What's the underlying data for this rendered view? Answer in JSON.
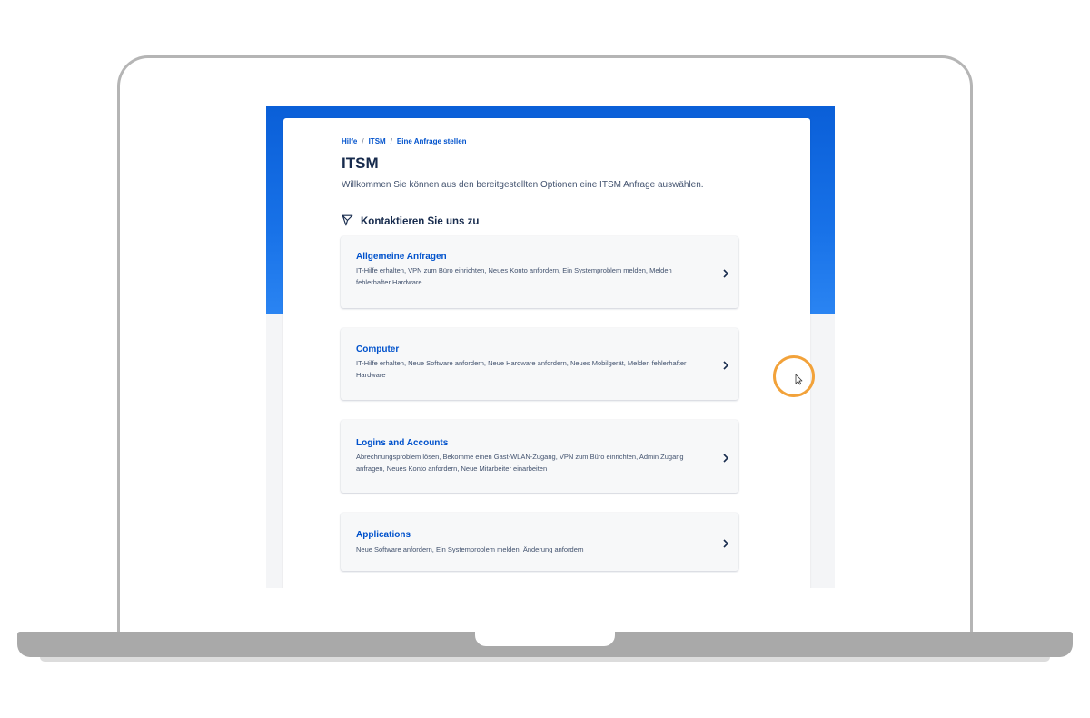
{
  "breadcrumb": [
    "Hilfe",
    "ITSM",
    "Eine Anfrage stellen"
  ],
  "breadcrumb_separator": "/",
  "page": {
    "title": "ITSM",
    "intro": "Willkommen Sie können aus den bereitgestellten Optionen eine ITSM Anfrage auswählen."
  },
  "contact": {
    "label": "Kontaktieren Sie uns zu",
    "icon": "send-icon"
  },
  "cards": [
    {
      "title": "Allgemeine Anfragen",
      "description": "IT-Hilfe erhalten, VPN zum Büro einrichten, Neues Konto anfordern, Ein Systemproblem melden, Melden fehlerhafter Hardware"
    },
    {
      "title": "Computer",
      "description": "IT-Hilfe erhalten, Neue Software anfordern, Neue Hardware anfordern, Neues Mobilgerät, Melden fehlerhafter Hardware"
    },
    {
      "title": "Logins and Accounts",
      "description": "Abrechnungsproblem lösen, Bekomme einen Gast-WLAN-Zugang, VPN zum Büro einrichten, Admin Zugang anfragen, Neues Konto anfordern, Neue Mitarbeiter einarbeiten"
    },
    {
      "title": "Applications",
      "description": "Neue Software anfordern, Ein Systemproblem melden, Änderung anfordern"
    }
  ],
  "colors": {
    "hero": "#0a5fd8",
    "link": "#0052cc",
    "cursor_ring": "#f2a23a",
    "frame": "#a9a9a9"
  }
}
